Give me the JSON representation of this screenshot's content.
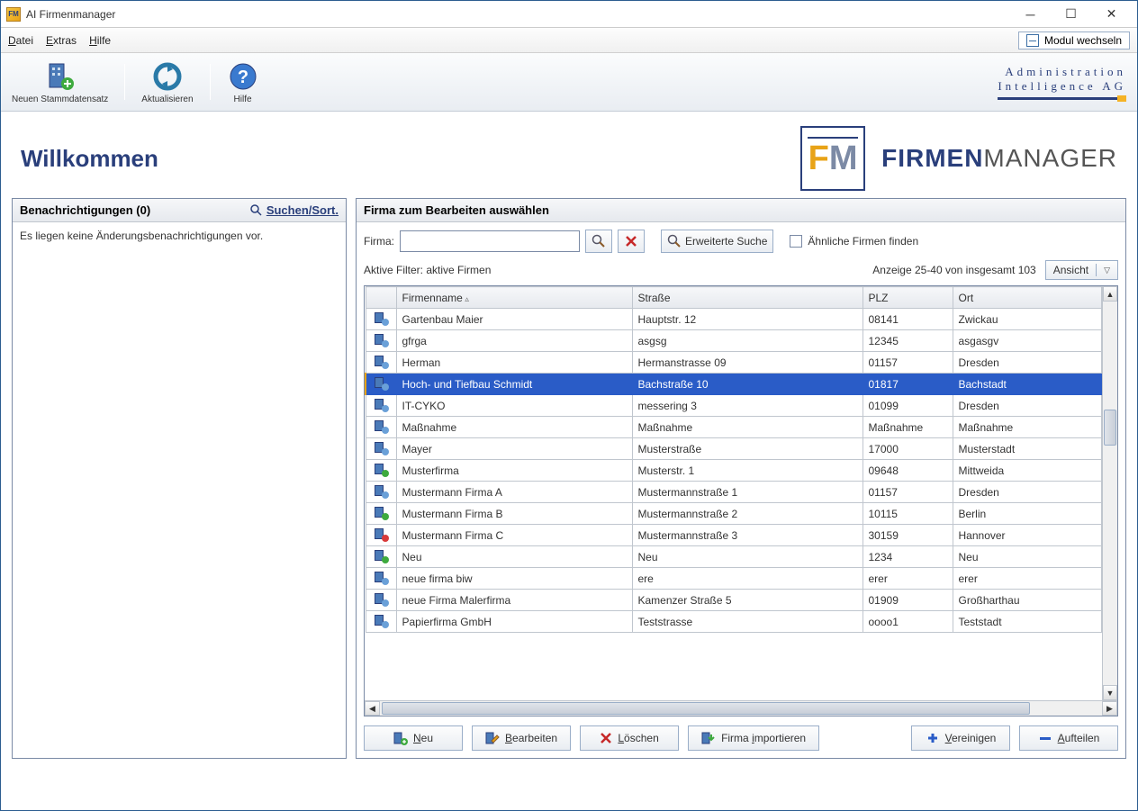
{
  "window": {
    "title": "AI Firmenmanager"
  },
  "menu": {
    "datei": "Datei",
    "extras": "Extras",
    "hilfe": "Hilfe",
    "modul_wechseln": "Modul wechseln"
  },
  "toolbar": {
    "neu": "Neuen Stammdatensatz",
    "aktualisieren": "Aktualisieren",
    "hilfe": "Hilfe",
    "brand1": "Administration",
    "brand2": "Intelligence AG"
  },
  "header": {
    "welcome": "Willkommen",
    "logo_firmen": "FIRMEN",
    "logo_manager": "MANAGER"
  },
  "left": {
    "title": "Benachrichtigungen (0)",
    "search_sort": "Suchen/Sort.",
    "empty": "Es liegen keine Änderungsbenachrichtigungen vor."
  },
  "right": {
    "title": "Firma zum Bearbeiten auswählen",
    "firma_label": "Firma:",
    "erweiterte_suche": "Erweiterte Suche",
    "aehnliche": "Ähnliche Firmen finden",
    "aktive_filter": "Aktive Filter: aktive Firmen",
    "anzeige": "Anzeige 25-40 von insgesamt 103",
    "ansicht": "Ansicht",
    "columns": {
      "name": "Firmenname",
      "strasse": "Straße",
      "plz": "PLZ",
      "ort": "Ort"
    },
    "rows": [
      {
        "icon": "q",
        "name": "Gartenbau Maier",
        "str": "Hauptstr. 12",
        "plz": "08141",
        "ort": "Zwickau"
      },
      {
        "icon": "q",
        "name": "gfrga",
        "str": "asgsg",
        "plz": "12345",
        "ort": "asgasgv"
      },
      {
        "icon": "q",
        "name": "Herman",
        "str": "Hermanstrasse 09",
        "plz": "01157",
        "ort": "Dresden"
      },
      {
        "icon": "q",
        "name": "Hoch- und Tiefbau Schmidt",
        "str": "Bachstraße 10",
        "plz": "01817",
        "ort": "Bachstadt",
        "sel": true
      },
      {
        "icon": "q",
        "name": "IT-CYKO",
        "str": "messering 3",
        "plz": "01099",
        "ort": "Dresden"
      },
      {
        "icon": "q",
        "name": "Maßnahme",
        "str": "Maßnahme",
        "plz": "Maßnahme",
        "ort": "Maßnahme"
      },
      {
        "icon": "q",
        "name": "Mayer",
        "str": "Musterstraße",
        "plz": "17000",
        "ort": "Musterstadt"
      },
      {
        "icon": "ok",
        "name": "Musterfirma",
        "str": "Musterstr. 1",
        "plz": "09648",
        "ort": "Mittweida"
      },
      {
        "icon": "q",
        "name": "Mustermann Firma A",
        "str": "Mustermannstraße 1",
        "plz": "01157",
        "ort": "Dresden"
      },
      {
        "icon": "ok",
        "name": "Mustermann Firma B",
        "str": "Mustermannstraße 2",
        "plz": "10115",
        "ort": "Berlin"
      },
      {
        "icon": "no",
        "name": "Mustermann Firma C",
        "str": "Mustermannstraße 3",
        "plz": "30159",
        "ort": "Hannover"
      },
      {
        "icon": "ok",
        "name": "Neu",
        "str": "Neu",
        "plz": "1234",
        "ort": "Neu"
      },
      {
        "icon": "q",
        "name": "neue firma biw",
        "str": "ere",
        "plz": "erer",
        "ort": "erer"
      },
      {
        "icon": "q",
        "name": "neue Firma Malerfirma",
        "str": "Kamenzer Straße 5",
        "plz": "01909",
        "ort": "Großharthau"
      },
      {
        "icon": "q",
        "name": "Papierfirma GmbH",
        "str": "Teststrasse",
        "plz": "oooo1",
        "ort": "Teststadt"
      }
    ],
    "buttons": {
      "neu": "Neu",
      "bearbeiten": "Bearbeiten",
      "loeschen": "Löschen",
      "importieren": "Firma importieren",
      "vereinigen": "Vereinigen",
      "aufteilen": "Aufteilen"
    }
  }
}
